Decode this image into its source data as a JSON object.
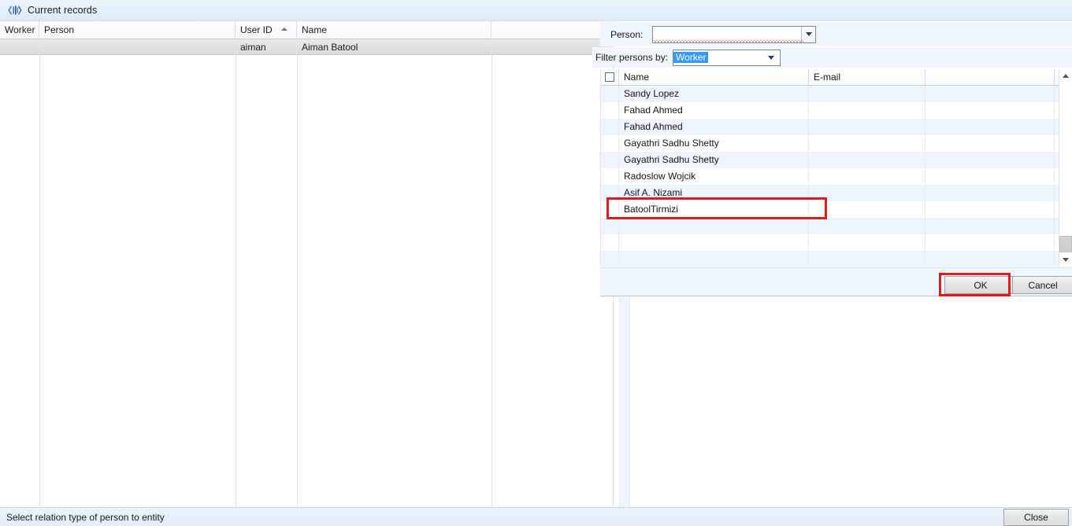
{
  "window": {
    "title": "Current records",
    "icon": "records-icon"
  },
  "records_grid": {
    "columns": [
      {
        "label": "Worker",
        "sorted": false
      },
      {
        "label": "Person",
        "sorted": false
      },
      {
        "label": "User ID",
        "sorted": true,
        "sort_direction": "asc"
      },
      {
        "label": "Name",
        "sorted": false
      },
      {
        "label": "",
        "sorted": false
      }
    ],
    "rows": [
      {
        "worker": "",
        "person": "",
        "user_id": "aiman",
        "name": "Aiman Batool",
        "tail": "",
        "selected": true
      }
    ]
  },
  "person_selector": {
    "label": "Person:",
    "value": "",
    "placeholder": "",
    "has_validation_error": true,
    "dropdown_icon": "chevron-down-icon"
  },
  "filter": {
    "label": "Filter persons by:",
    "value": "Worker",
    "selected_highlight": true,
    "dropdown_icon": "chevron-down-icon",
    "options": [
      "Worker"
    ]
  },
  "person_list": {
    "select_all_checkbox": false,
    "columns": [
      {
        "label": "Name"
      },
      {
        "label": "E-mail"
      },
      {
        "label": ""
      }
    ],
    "rows": [
      {
        "name": "Sandy Lopez",
        "email": ""
      },
      {
        "name": "Fahad Ahmed",
        "email": ""
      },
      {
        "name": "Fahad Ahmed",
        "email": ""
      },
      {
        "name": "Gayathri Sadhu Shetty",
        "email": ""
      },
      {
        "name": "Gayathri Sadhu Shetty",
        "email": ""
      },
      {
        "name": "Radoslow Wojcik",
        "email": ""
      },
      {
        "name": "Asif A. Nizami",
        "email": ""
      },
      {
        "name": "BatoolTirmizi",
        "email": ""
      },
      {
        "name": "",
        "email": ""
      },
      {
        "name": "",
        "email": ""
      },
      {
        "name": "",
        "email": ""
      }
    ],
    "scrollbar": {
      "up_icon": "chevron-up-icon",
      "down_icon": "chevron-down-icon"
    }
  },
  "dialog_buttons": {
    "ok_label": "OK",
    "cancel_label": "Cancel"
  },
  "annotations": {
    "highlight_color": "#e01b1b",
    "targets": [
      "person-list-row-batooltirmizi",
      "ok-button"
    ]
  },
  "statusbar": {
    "message": "Select relation type of person to entity",
    "close_label": "Close"
  }
}
